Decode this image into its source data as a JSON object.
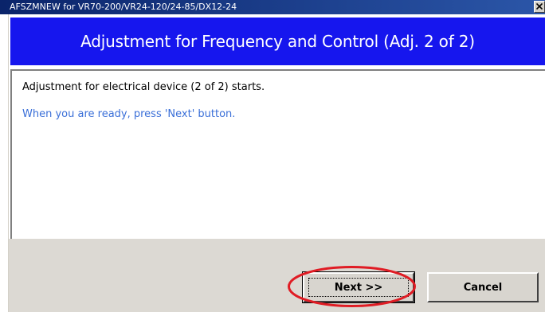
{
  "window": {
    "title": "AFSZMNEW for VR70-200/VR24-120/24-85/DX12-24"
  },
  "banner": {
    "title": "Adjustment for Frequency and Control (Adj. 2 of 2)"
  },
  "content": {
    "line1": "Adjustment for electrical device (2 of 2) starts.",
    "line2": "When you are ready, press 'Next' button."
  },
  "buttons": {
    "next_label": "Next >>",
    "cancel_label": "Cancel"
  },
  "colors": {
    "banner": "#1616ee",
    "instruction_text": "#3a6fd8",
    "highlight": "#e01c24"
  }
}
